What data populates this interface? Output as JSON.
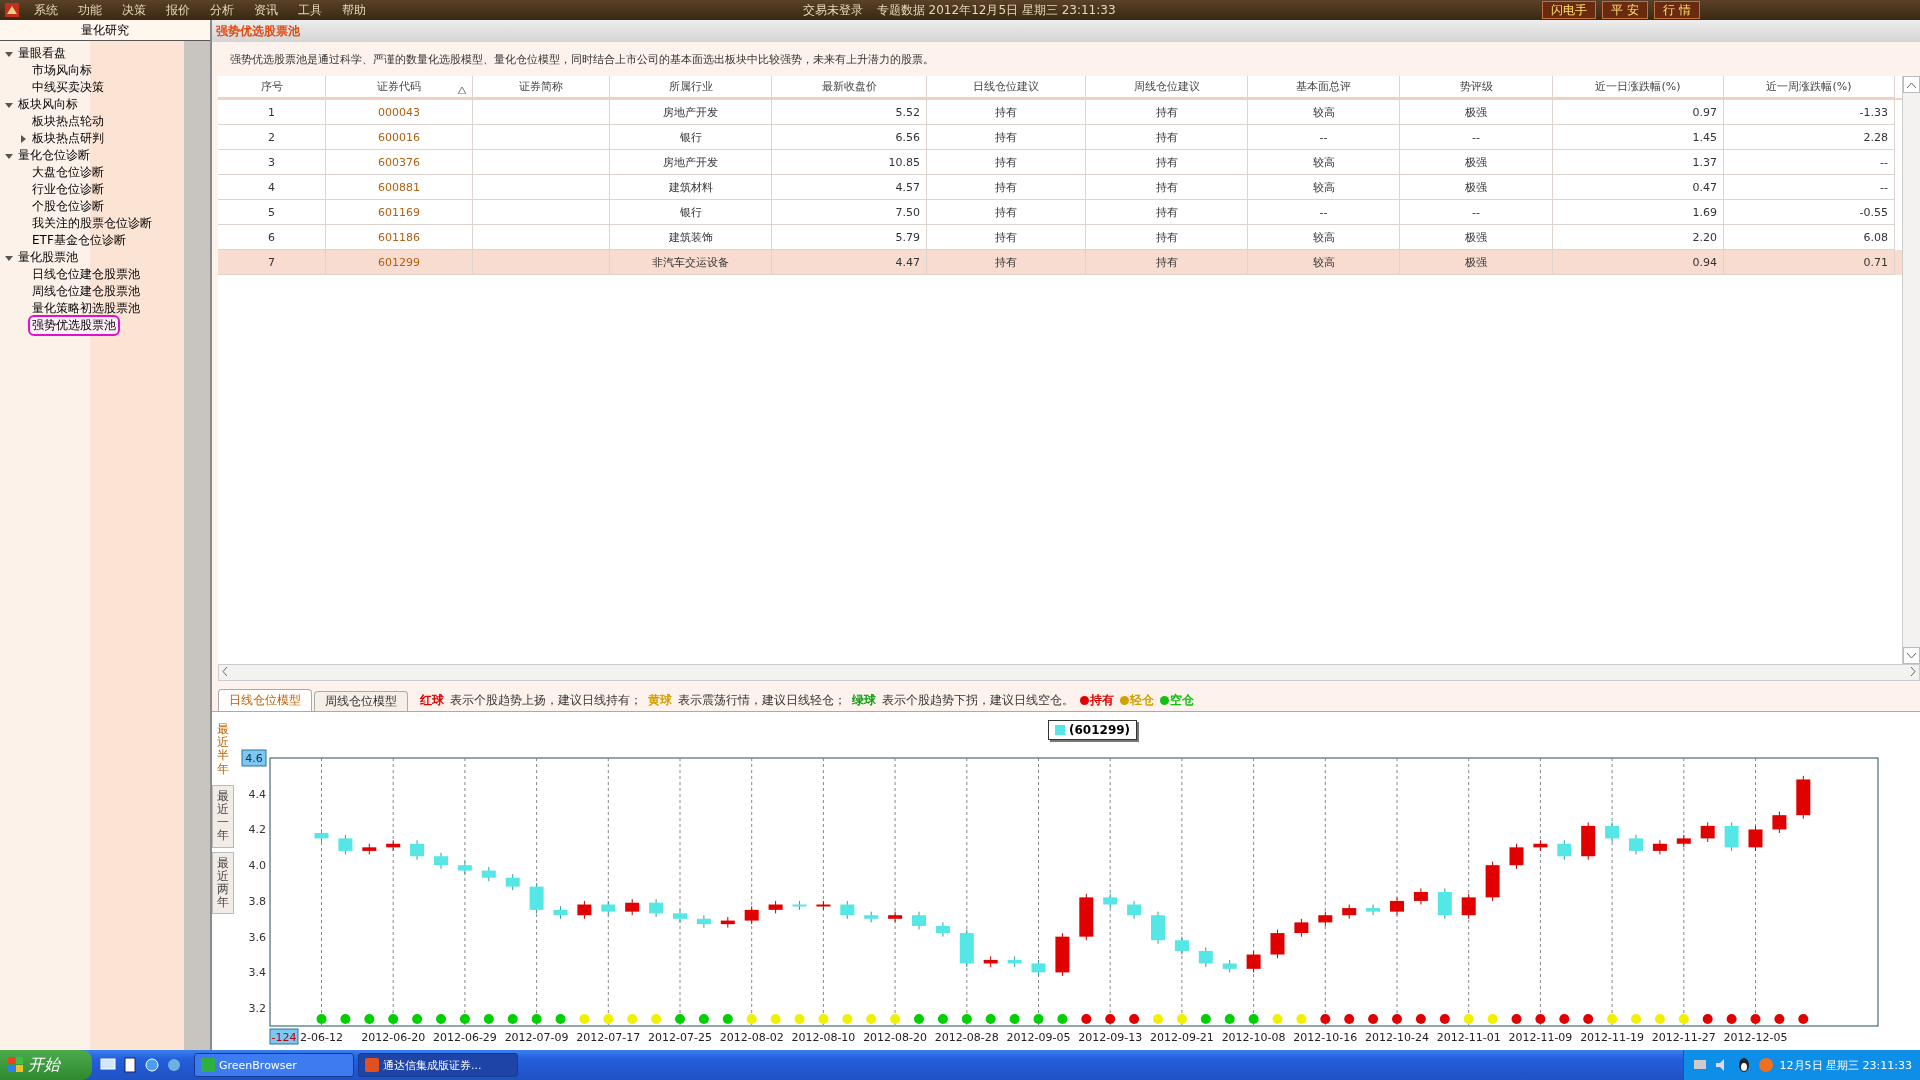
{
  "menubar": {
    "menus": [
      "系统",
      "功能",
      "决策",
      "报价",
      "分析",
      "资讯",
      "工具",
      "帮助"
    ],
    "status": "交易未登录",
    "info": "专题数据 2012年12月5日 星期三 23:11:33",
    "buttons": [
      "闪电手",
      "平 安",
      "行 情"
    ]
  },
  "sidebar": {
    "title": "量化研究",
    "tree": [
      {
        "label": "量眼看盘",
        "kind": "group",
        "expanded": true,
        "selected": false,
        "children": [
          {
            "label": "市场风向标",
            "kind": "item",
            "selected": false
          },
          {
            "label": "中线买卖决策",
            "kind": "item",
            "selected": false
          }
        ]
      },
      {
        "label": "板块风向标",
        "kind": "group",
        "expanded": true,
        "selected": false,
        "children": [
          {
            "label": "板块热点轮动",
            "kind": "item",
            "selected": false
          },
          {
            "label": "板块热点研判",
            "kind": "group",
            "expanded": false,
            "selected": false
          }
        ]
      },
      {
        "label": "量化仓位诊断",
        "kind": "group",
        "expanded": true,
        "selected": false,
        "children": [
          {
            "label": "大盘仓位诊断",
            "kind": "item",
            "selected": false
          },
          {
            "label": "行业仓位诊断",
            "kind": "item",
            "selected": false
          },
          {
            "label": "个股仓位诊断",
            "kind": "item",
            "selected": false
          },
          {
            "label": "我关注的股票仓位诊断",
            "kind": "item",
            "selected": false
          },
          {
            "label": "ETF基金仓位诊断",
            "kind": "item",
            "selected": false
          }
        ]
      },
      {
        "label": "量化股票池",
        "kind": "group",
        "expanded": true,
        "selected": false,
        "children": [
          {
            "label": "日线仓位建仓股票池",
            "kind": "item",
            "selected": false
          },
          {
            "label": "周线仓位建仓股票池",
            "kind": "item",
            "selected": false
          },
          {
            "label": "量化策略初选股票池",
            "kind": "item",
            "selected": false
          },
          {
            "label": "强势优选股票池",
            "kind": "item",
            "selected": true
          }
        ]
      }
    ]
  },
  "page": {
    "title": "强势优选股票池",
    "description": "强势优选股票池是通过科学、严谨的数量化选股模型、量化仓位模型，同时结合上市公司的基本面选出板块中比较强势，未来有上升潜力的股票。"
  },
  "table": {
    "columns": [
      {
        "label": "序号",
        "sorted": false
      },
      {
        "label": "证券代码",
        "sorted": true
      },
      {
        "label": "证券简称",
        "sorted": false
      },
      {
        "label": "所属行业",
        "sorted": false
      },
      {
        "label": "最新收盘价",
        "sorted": false
      },
      {
        "label": "日线仓位建议",
        "sorted": false
      },
      {
        "label": "周线仓位建议",
        "sorted": false
      },
      {
        "label": "基本面总评",
        "sorted": false
      },
      {
        "label": "势评级",
        "sorted": false
      },
      {
        "label": "近一日涨跌幅(%)",
        "sorted": false
      },
      {
        "label": "近一周涨跌幅(%)",
        "sorted": false
      }
    ],
    "rows": [
      {
        "cells": [
          "1",
          "000043",
          "",
          "房地产开发",
          "5.52",
          "持有",
          "持有",
          "较高",
          "极强",
          "0.97",
          "-1.33"
        ],
        "selected": false
      },
      {
        "cells": [
          "2",
          "600016",
          "",
          "银行",
          "6.56",
          "持有",
          "持有",
          "--",
          "--",
          "1.45",
          "2.28"
        ],
        "selected": false
      },
      {
        "cells": [
          "3",
          "600376",
          "",
          "房地产开发",
          "10.85",
          "持有",
          "持有",
          "较高",
          "极强",
          "1.37",
          "--"
        ],
        "selected": false
      },
      {
        "cells": [
          "4",
          "600881",
          "",
          "建筑材料",
          "4.57",
          "持有",
          "持有",
          "较高",
          "极强",
          "0.47",
          "--"
        ],
        "selected": false
      },
      {
        "cells": [
          "5",
          "601169",
          "",
          "银行",
          "7.50",
          "持有",
          "持有",
          "--",
          "--",
          "1.69",
          "-0.55"
        ],
        "selected": false
      },
      {
        "cells": [
          "6",
          "601186",
          "",
          "建筑装饰",
          "5.79",
          "持有",
          "持有",
          "较高",
          "极强",
          "2.20",
          "6.08"
        ],
        "selected": false
      },
      {
        "cells": [
          "7",
          "601299",
          "",
          "非汽车交运设备",
          "4.47",
          "持有",
          "持有",
          "较高",
          "极强",
          "0.94",
          "0.71"
        ],
        "selected": true
      }
    ]
  },
  "bottom": {
    "tabs": [
      {
        "label": "日线仓位模型",
        "selected": true
      },
      {
        "label": "周线仓位模型",
        "selected": false
      }
    ],
    "legend": [
      {
        "label": "红球",
        "text": "表示个股趋势上扬，建议日线持有；",
        "color": "#e00000"
      },
      {
        "label": "黄球",
        "text": "表示震荡行情，建议日线轻仓；",
        "color": "#d4a000"
      },
      {
        "label": "绿球",
        "text": "表示个股趋势下拐，建议日线空仓。",
        "color": "#10a010"
      }
    ],
    "key": [
      {
        "label": "持有",
        "color": "#e00000"
      },
      {
        "label": "轻仓",
        "color": "#d4a000"
      },
      {
        "label": "空仓",
        "color": "#10c010"
      }
    ],
    "periods": [
      {
        "label": "最近半年",
        "selected": true
      },
      {
        "label": "最近一年",
        "selected": false
      },
      {
        "label": "最近两年",
        "selected": false
      }
    ],
    "cursor_value": "4.6",
    "cursor_index": "-124",
    "series_legend": {
      "name": "(601299)",
      "color": "#55e6e6"
    },
    "chart_data": {
      "type": "candlestick",
      "grid": "x",
      "ylim": [
        3.1,
        4.6
      ],
      "yticks": [
        3.2,
        3.4,
        3.6,
        {
          "value": 4.0,
          "label": "4.0"
        },
        3.8,
        4.2,
        4.4
      ],
      "categories": [
        "2-06-12",
        null,
        null,
        "2012-06-20",
        null,
        null,
        "2012-06-29",
        null,
        null,
        "2012-07-09",
        null,
        null,
        "2012-07-17",
        null,
        null,
        "2012-07-25",
        null,
        null,
        "2012-08-02",
        null,
        null,
        "2012-08-10",
        null,
        null,
        "2012-08-20",
        null,
        null,
        "2012-08-28",
        null,
        null,
        "2012-09-05",
        null,
        null,
        "2012-09-13",
        null,
        null,
        "2012-09-21",
        null,
        null,
        "2012-10-08",
        null,
        null,
        "2012-10-16",
        null,
        null,
        "2012-10-24",
        null,
        null,
        "2012-11-01",
        null,
        null,
        "2012-11-09",
        null,
        null,
        "2012-11-19",
        null,
        null,
        "2012-11-27",
        null,
        null,
        "2012-12-05",
        null,
        null
      ],
      "ohlc": [
        [
          4.18,
          4.2,
          4.13,
          4.15
        ],
        [
          4.15,
          4.17,
          4.06,
          4.08
        ],
        [
          4.08,
          4.12,
          4.06,
          4.1
        ],
        [
          4.1,
          4.14,
          4.08,
          4.12
        ],
        [
          4.12,
          4.14,
          4.03,
          4.05
        ],
        [
          4.05,
          4.07,
          3.98,
          4.0
        ],
        [
          4.0,
          4.02,
          3.95,
          3.97
        ],
        [
          3.97,
          3.99,
          3.91,
          3.93
        ],
        [
          3.93,
          3.95,
          3.86,
          3.88
        ],
        [
          3.88,
          3.9,
          3.73,
          3.75
        ],
        [
          3.75,
          3.77,
          3.7,
          3.72
        ],
        [
          3.72,
          3.8,
          3.7,
          3.78
        ],
        [
          3.78,
          3.8,
          3.72,
          3.74
        ],
        [
          3.74,
          3.81,
          3.72,
          3.79
        ],
        [
          3.79,
          3.81,
          3.71,
          3.73
        ],
        [
          3.73,
          3.75,
          3.68,
          3.7
        ],
        [
          3.7,
          3.72,
          3.65,
          3.67
        ],
        [
          3.67,
          3.71,
          3.65,
          3.69
        ],
        [
          3.69,
          3.77,
          3.67,
          3.75
        ],
        [
          3.75,
          3.8,
          3.73,
          3.78
        ],
        [
          3.78,
          3.8,
          3.75,
          3.77
        ],
        [
          3.77,
          3.8,
          3.75,
          3.78
        ],
        [
          3.78,
          3.8,
          3.7,
          3.72
        ],
        [
          3.72,
          3.74,
          3.68,
          3.7
        ],
        [
          3.7,
          3.74,
          3.68,
          3.72
        ],
        [
          3.72,
          3.74,
          3.64,
          3.66
        ],
        [
          3.66,
          3.68,
          3.6,
          3.62
        ],
        [
          3.62,
          3.64,
          3.43,
          3.45
        ],
        [
          3.45,
          3.49,
          3.43,
          3.47
        ],
        [
          3.47,
          3.49,
          3.43,
          3.45
        ],
        [
          3.45,
          3.47,
          3.38,
          3.4
        ],
        [
          3.4,
          3.62,
          3.38,
          3.6
        ],
        [
          3.6,
          3.84,
          3.58,
          3.82
        ],
        [
          3.82,
          3.84,
          3.76,
          3.78
        ],
        [
          3.78,
          3.8,
          3.7,
          3.72
        ],
        [
          3.72,
          3.74,
          3.56,
          3.58
        ],
        [
          3.58,
          3.6,
          3.5,
          3.52
        ],
        [
          3.52,
          3.54,
          3.43,
          3.45
        ],
        [
          3.45,
          3.47,
          3.4,
          3.42
        ],
        [
          3.42,
          3.52,
          3.4,
          3.5
        ],
        [
          3.5,
          3.64,
          3.48,
          3.62
        ],
        [
          3.62,
          3.7,
          3.6,
          3.68
        ],
        [
          3.68,
          3.74,
          3.66,
          3.72
        ],
        [
          3.72,
          3.78,
          3.7,
          3.76
        ],
        [
          3.76,
          3.78,
          3.72,
          3.74
        ],
        [
          3.74,
          3.82,
          3.72,
          3.8
        ],
        [
          3.8,
          3.87,
          3.78,
          3.85
        ],
        [
          3.85,
          3.87,
          3.7,
          3.72
        ],
        [
          3.72,
          3.84,
          3.7,
          3.82
        ],
        [
          3.82,
          4.02,
          3.8,
          4.0
        ],
        [
          4.0,
          4.12,
          3.98,
          4.1
        ],
        [
          4.1,
          4.14,
          4.08,
          4.12
        ],
        [
          4.12,
          4.14,
          4.03,
          4.05
        ],
        [
          4.05,
          4.24,
          4.03,
          4.22
        ],
        [
          4.22,
          4.24,
          4.13,
          4.15
        ],
        [
          4.15,
          4.17,
          4.06,
          4.08
        ],
        [
          4.08,
          4.14,
          4.06,
          4.12
        ],
        [
          4.12,
          4.17,
          4.1,
          4.15
        ],
        [
          4.15,
          4.24,
          4.13,
          4.22
        ],
        [
          4.22,
          4.24,
          4.08,
          4.1
        ],
        [
          4.1,
          4.22,
          4.08,
          4.2
        ],
        [
          4.2,
          4.3,
          4.18,
          4.28
        ],
        [
          4.28,
          4.5,
          4.26,
          4.48
        ]
      ]
    },
    "signals": [
      {
        "color": "#00d000"
      },
      {
        "color": "#00d000"
      },
      {
        "color": "#00d000"
      },
      {
        "color": "#00d000"
      },
      {
        "color": "#00d000"
      },
      {
        "color": "#00d000"
      },
      {
        "color": "#00d000"
      },
      {
        "color": "#00d000"
      },
      {
        "color": "#00d000"
      },
      {
        "color": "#00d000"
      },
      {
        "color": "#00d000"
      },
      {
        "color": "#f0f000"
      },
      {
        "color": "#f0f000"
      },
      {
        "color": "#f0f000"
      },
      {
        "color": "#f0f000"
      },
      {
        "color": "#00d000"
      },
      {
        "color": "#00d000"
      },
      {
        "color": "#00d000"
      },
      {
        "color": "#f0f000"
      },
      {
        "color": "#f0f000"
      },
      {
        "color": "#f0f000"
      },
      {
        "color": "#f0f000"
      },
      {
        "color": "#f0f000"
      },
      {
        "color": "#f0f000"
      },
      {
        "color": "#f0f000"
      },
      {
        "color": "#00d000"
      },
      {
        "color": "#00d000"
      },
      {
        "color": "#00d000"
      },
      {
        "color": "#00d000"
      },
      {
        "color": "#00d000"
      },
      {
        "color": "#00d000"
      },
      {
        "color": "#00d000"
      },
      {
        "color": "#e00000"
      },
      {
        "color": "#e00000"
      },
      {
        "color": "#e00000"
      },
      {
        "color": "#f0f000"
      },
      {
        "color": "#f0f000"
      },
      {
        "color": "#00d000"
      },
      {
        "color": "#00d000"
      },
      {
        "color": "#00d000"
      },
      {
        "color": "#f0f000"
      },
      {
        "color": "#f0f000"
      },
      {
        "color": "#e00000"
      },
      {
        "color": "#e00000"
      },
      {
        "color": "#e00000"
      },
      {
        "color": "#e00000"
      },
      {
        "color": "#e00000"
      },
      {
        "color": "#e00000"
      },
      {
        "color": "#f0f000"
      },
      {
        "color": "#f0f000"
      },
      {
        "color": "#e00000"
      },
      {
        "color": "#e00000"
      },
      {
        "color": "#e00000"
      },
      {
        "color": "#e00000"
      },
      {
        "color": "#f0f000"
      },
      {
        "color": "#f0f000"
      },
      {
        "color": "#f0f000"
      },
      {
        "color": "#f0f000"
      },
      {
        "color": "#e00000"
      },
      {
        "color": "#e00000"
      },
      {
        "color": "#e00000"
      },
      {
        "color": "#e00000"
      },
      {
        "color": "#e00000"
      }
    ]
  },
  "taskbar": {
    "start": "开始",
    "tasks": [
      {
        "label": "GreenBrowser",
        "selected": false
      },
      {
        "label": "通达信集成版证券...",
        "selected": true
      }
    ],
    "clock": "12月5日 星期三 23:11:33"
  }
}
